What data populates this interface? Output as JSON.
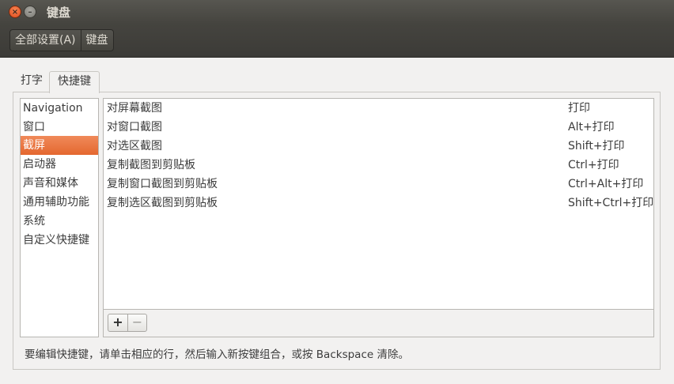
{
  "window": {
    "title": "键盘",
    "close_glyph": "×",
    "minimize_glyph": "–"
  },
  "breadcrumb": {
    "items": [
      "全部设置(A)",
      "键盘"
    ]
  },
  "tabs": [
    {
      "label": "打字"
    },
    {
      "label": "快捷键",
      "active": true
    }
  ],
  "categories": [
    {
      "label": "Navigation"
    },
    {
      "label": "窗口"
    },
    {
      "label": "截屏",
      "selected": true
    },
    {
      "label": "启动器"
    },
    {
      "label": "声音和媒体"
    },
    {
      "label": "通用辅助功能"
    },
    {
      "label": "系统"
    },
    {
      "label": "自定义快捷键"
    }
  ],
  "shortcuts": [
    {
      "name": "对屏幕截图",
      "accel": "打印"
    },
    {
      "name": "对窗口截图",
      "accel": "Alt+打印"
    },
    {
      "name": "对选区截图",
      "accel": "Shift+打印"
    },
    {
      "name": "复制截图到剪贴板",
      "accel": "Ctrl+打印"
    },
    {
      "name": "复制窗口截图到剪贴板",
      "accel": "Ctrl+Alt+打印"
    },
    {
      "name": "复制选区截图到剪贴板",
      "accel": "Shift+Ctrl+打印"
    }
  ],
  "actions": {
    "add": "+",
    "remove": "−"
  },
  "hint": "要编辑快捷键，请单击相应的行，然后输入新按键组合，或按 Backspace 清除。",
  "colors": {
    "selection": "#e4672f",
    "titlebar": "#45443f"
  }
}
